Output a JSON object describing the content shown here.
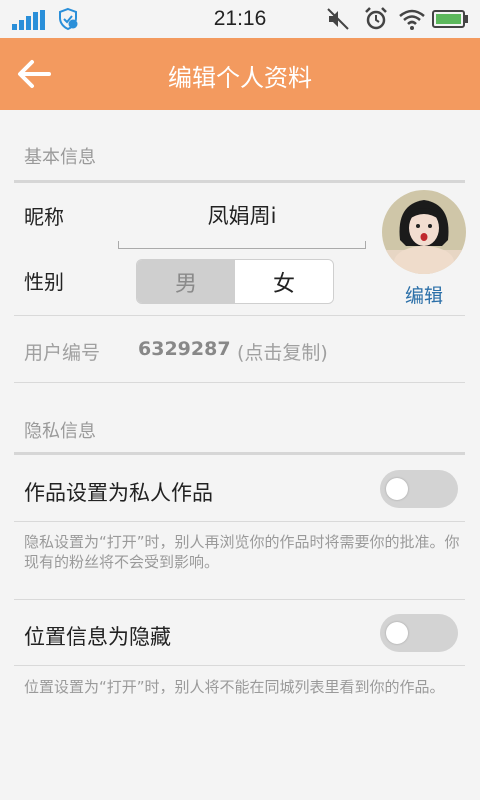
{
  "status_bar": {
    "time": "21:16",
    "icons": [
      "signal-icon",
      "shield-icon",
      "mute-icon",
      "alarm-icon",
      "wifi-icon",
      "battery-icon"
    ],
    "accent_color": "#2a8fd9"
  },
  "header": {
    "title": "编辑个人资料",
    "back_icon": "back-arrow-icon",
    "color": "#f39a5f"
  },
  "basic_info": {
    "section_title": "基本信息",
    "nickname_label": "昵称",
    "nickname_value": "凤娟周i",
    "gender_label": "性别",
    "gender_options": [
      "男",
      "女"
    ],
    "gender_selected": "女",
    "avatar_edit": "编辑",
    "user_id_label": "用户编号",
    "user_id_value": "6329287",
    "copy_hint": "(点击复制)"
  },
  "privacy_info": {
    "section_title": "隐私信息",
    "private_works": {
      "label": "作品设置为私人作品",
      "enabled": false,
      "note": "隐私设置为“打开”时，别人再浏览你的作品时将需要你的批准。你现有的粉丝将不会受到影响。"
    },
    "hide_location": {
      "label": "位置信息为隐藏",
      "enabled": false,
      "note": "位置设置为“打开”时，别人将不能在同城列表里看到你的作品。"
    }
  }
}
